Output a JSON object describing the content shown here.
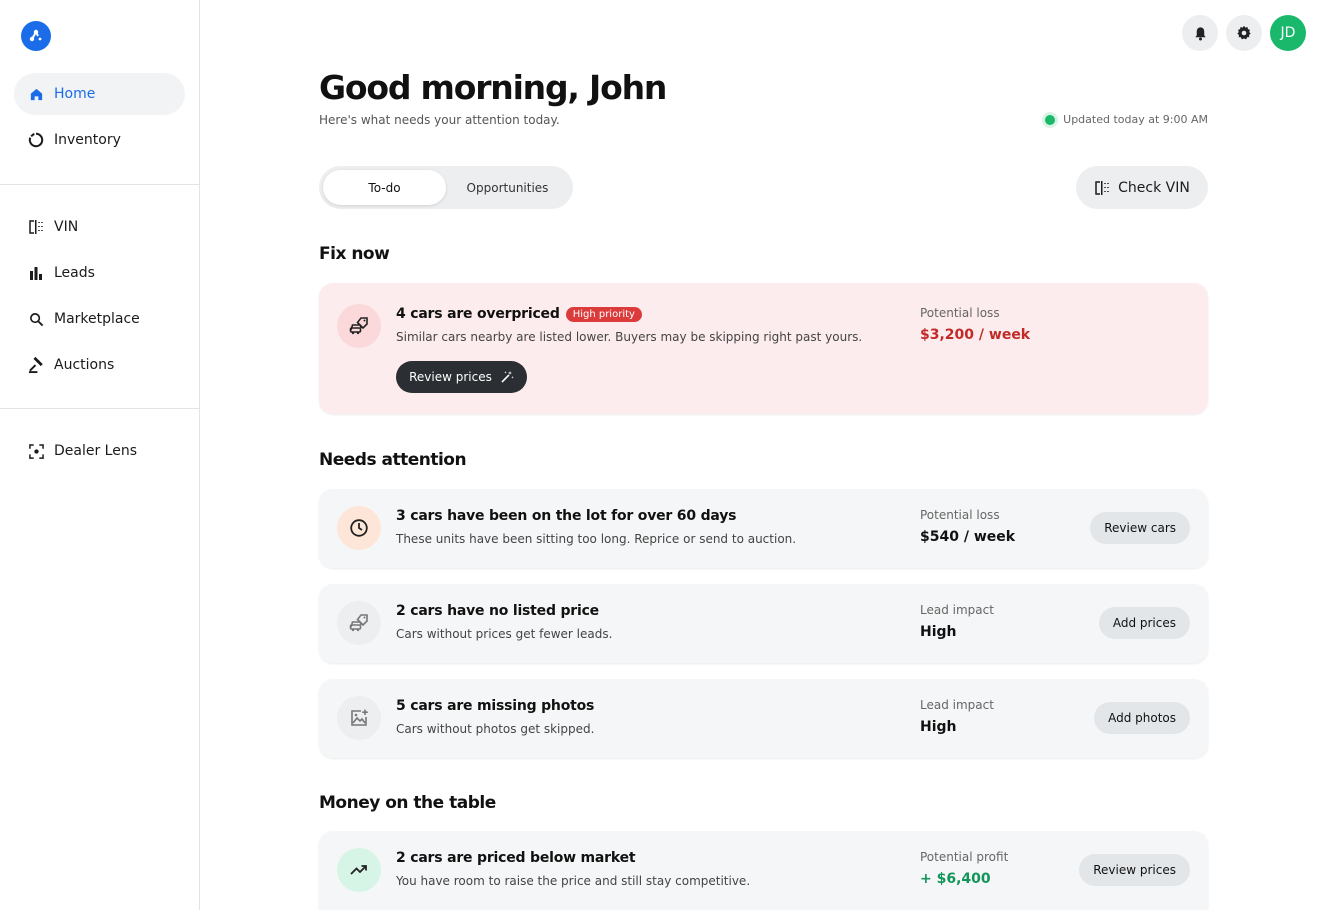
{
  "sidebar": {
    "items": [
      {
        "label": "Home",
        "icon": "home-icon",
        "active": true
      },
      {
        "label": "Inventory",
        "icon": "ring-icon"
      },
      {
        "label": "VIN",
        "icon": "vin-icon"
      },
      {
        "label": "Leads",
        "icon": "bar-chart-icon"
      },
      {
        "label": "Marketplace",
        "icon": "search-icon"
      },
      {
        "label": "Auctions",
        "icon": "gavel-icon"
      },
      {
        "label": "Dealer Lens",
        "icon": "focus-icon"
      }
    ]
  },
  "header": {
    "avatar_initials": "JD",
    "greeting": "Good morning, John",
    "subtitle": "Here's what needs your attention today.",
    "updated": "Updated today at 9:00 AM"
  },
  "tabs": [
    {
      "label": "To-do",
      "active": true
    },
    {
      "label": "Opportunities"
    }
  ],
  "check_vin_label": "Check VIN",
  "sections": {
    "fix_now": "Fix now",
    "needs_attention": "Needs attention",
    "money": "Money on the table"
  },
  "fix_now_card": {
    "title": "4 cars are overpriced",
    "badge": "High priority",
    "desc": "Similar cars nearby are listed lower. Buyers may be skipping right past yours.",
    "action": "Review prices",
    "metric_label": "Potential loss",
    "metric_value": "$3,200 / week"
  },
  "attention_cards": [
    {
      "title": "3 cars have been on the lot for over 60 days",
      "desc": "These units have been sitting too long. Reprice or send to auction.",
      "metric_label": "Potential loss",
      "metric_value": "$540 / week",
      "action": "Review cars"
    },
    {
      "title": "2 cars have no listed price",
      "desc": "Cars without prices get fewer leads.",
      "metric_label": "Lead impact",
      "metric_value": "High",
      "action": "Add prices"
    },
    {
      "title": "5 cars are missing photos",
      "desc": "Cars without photos get skipped.",
      "metric_label": "Lead impact",
      "metric_value": "High",
      "action": "Add photos"
    }
  ],
  "money_card": {
    "title": "2 cars are priced below market",
    "desc": "You have room to raise the price and still stay competitive.",
    "metric_label": "Potential profit",
    "metric_value": "+ $6,400",
    "action": "Review prices"
  },
  "colors": {
    "accent": "#1a6ce8",
    "danger": "#dc3b3b",
    "danger_text": "#c22a2a",
    "success": "#19b86b",
    "profit_text": "#12955a"
  }
}
